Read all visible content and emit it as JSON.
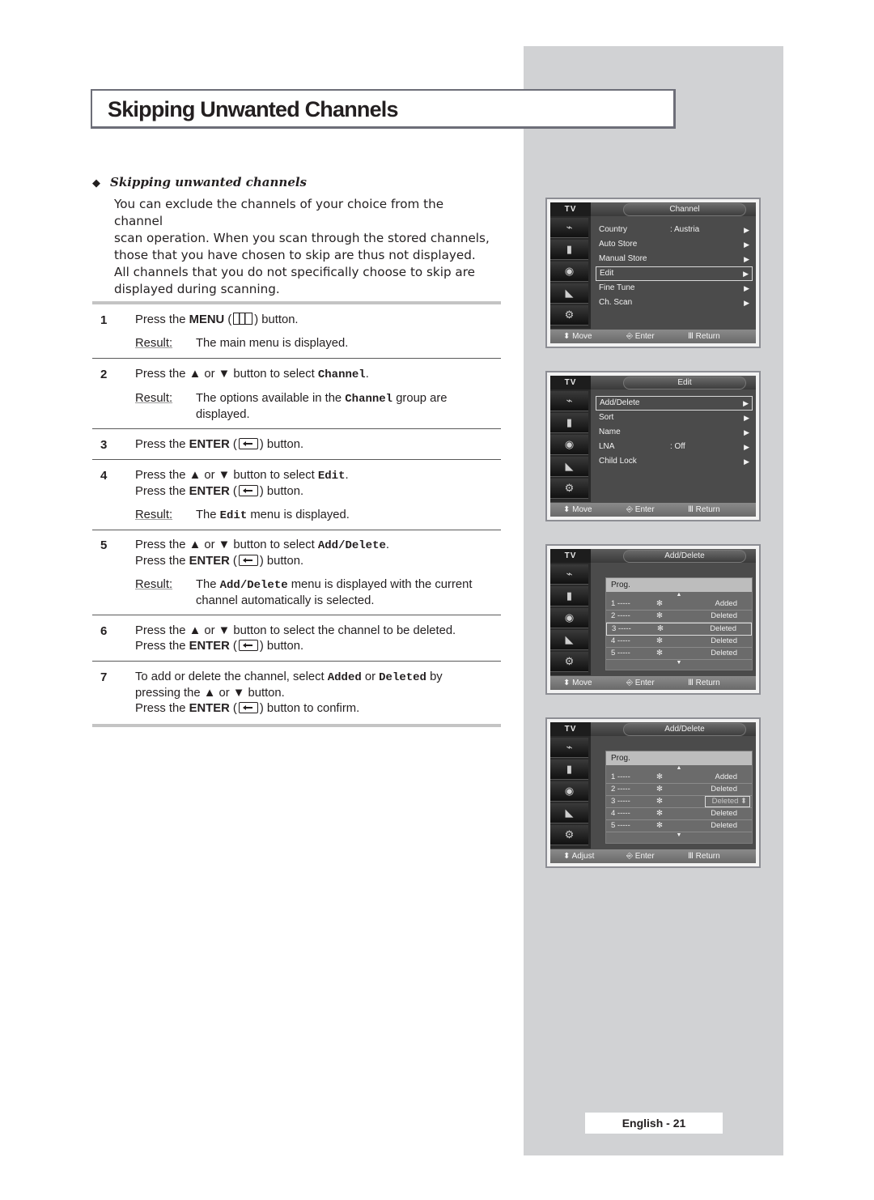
{
  "page": {
    "title": "Skipping Unwanted Channels",
    "subheading": "Skipping unwanted channels",
    "bullet_icon": "diamond-bullet",
    "intro_lines": [
      "You can exclude the channels of your choice from the channel",
      "scan operation. When you scan through the stored channels,",
      "those that you have chosen to skip are thus not displayed.",
      "All channels that you do not specifically choose to skip are",
      "displayed during scanning."
    ],
    "result_label": "Result",
    "footer": "English - 21"
  },
  "steps": [
    {
      "num": "1",
      "lines": [
        [
          "Press the ",
          {
            "b": "MENU"
          },
          " (",
          {
            "icon": "menu"
          },
          ") button."
        ]
      ],
      "result": [
        [
          "The main menu is displayed."
        ]
      ]
    },
    {
      "num": "2",
      "lines": [
        [
          "Press the ▲ or ▼ button to select ",
          {
            "mono": "Channel"
          },
          "."
        ]
      ],
      "result": [
        [
          "The options available in the ",
          {
            "mono": "Channel"
          },
          " group are"
        ],
        [
          "displayed."
        ]
      ]
    },
    {
      "num": "3",
      "lines": [
        [
          "Press the ",
          {
            "b": "ENTER"
          },
          " (",
          {
            "icon": "enter"
          },
          ") button."
        ]
      ]
    },
    {
      "num": "4",
      "lines": [
        [
          "Press the ▲ or ▼ button to select ",
          {
            "mono": "Edit"
          },
          "."
        ],
        [
          "Press the ",
          {
            "b": "ENTER"
          },
          " (",
          {
            "icon": "enter"
          },
          ") button."
        ]
      ],
      "result": [
        [
          "The ",
          {
            "mono": "Edit"
          },
          " menu is displayed."
        ]
      ]
    },
    {
      "num": "5",
      "lines": [
        [
          "Press the ▲ or ▼ button to select ",
          {
            "mono": "Add/Delete"
          },
          "."
        ],
        [
          "Press the ",
          {
            "b": "ENTER"
          },
          " (",
          {
            "icon": "enter"
          },
          ") button."
        ]
      ],
      "result": [
        [
          "The ",
          {
            "mono": "Add/Delete"
          },
          " menu is displayed with the current"
        ],
        [
          "channel automatically is selected."
        ]
      ]
    },
    {
      "num": "6",
      "lines": [
        [
          "Press the ▲ or ▼ button to select the channel to be deleted."
        ],
        [
          "Press the ",
          {
            "b": "ENTER"
          },
          " (",
          {
            "icon": "enter"
          },
          ") button."
        ]
      ]
    },
    {
      "num": "7",
      "lines": [
        [
          "To add or delete the channel, select ",
          {
            "mono": "Added"
          },
          " or ",
          {
            "mono": "Deleted"
          },
          " by"
        ],
        [
          "pressing the ▲ or ▼ button."
        ],
        [
          "Press the ",
          {
            "b": "ENTER"
          },
          " (",
          {
            "icon": "enter"
          },
          ") button to confirm."
        ]
      ]
    }
  ],
  "tv_screens": [
    {
      "tv_label": "TV",
      "title": "Channel",
      "type": "menu",
      "items": [
        {
          "label": "Country",
          "value": ":  Austria",
          "arrow": "▶",
          "selected": false
        },
        {
          "label": "Auto Store",
          "value": "",
          "arrow": "▶",
          "selected": false
        },
        {
          "label": "Manual Store",
          "value": "",
          "arrow": "▶",
          "selected": false
        },
        {
          "label": "Edit",
          "value": "",
          "arrow": "▶",
          "selected": true
        },
        {
          "label": "Fine Tune",
          "value": "",
          "arrow": "▶",
          "selected": false
        },
        {
          "label": "Ch. Scan",
          "value": "",
          "arrow": "▶",
          "selected": false
        }
      ],
      "footer": {
        "nav": "Move",
        "enter": "Enter",
        "return": "Return"
      }
    },
    {
      "tv_label": "TV",
      "title": "Edit",
      "type": "menu",
      "items": [
        {
          "label": "Add/Delete",
          "value": "",
          "arrow": "▶",
          "selected": true
        },
        {
          "label": "Sort",
          "value": "",
          "arrow": "▶",
          "selected": false
        },
        {
          "label": "Name",
          "value": "",
          "arrow": "▶",
          "selected": false
        },
        {
          "label": "LNA",
          "value": ":  Off",
          "arrow": "▶",
          "selected": false
        },
        {
          "label": "Child Lock",
          "value": "",
          "arrow": "▶",
          "selected": false
        }
      ],
      "footer": {
        "nav": "Move",
        "enter": "Enter",
        "return": "Return"
      }
    },
    {
      "tv_label": "TV",
      "title": "Add/Delete",
      "type": "list",
      "list_header": "Prog.",
      "rows": [
        {
          "prog": "1 -----",
          "mark": "✻",
          "status": "Added",
          "selected": false
        },
        {
          "prog": "2 -----",
          "mark": "✻",
          "status": "Deleted",
          "selected": false
        },
        {
          "prog": "3 -----",
          "mark": "✻",
          "status": "Deleted",
          "selected": true
        },
        {
          "prog": "4 -----",
          "mark": "✻",
          "status": "Deleted",
          "selected": false
        },
        {
          "prog": "5 -----",
          "mark": "✻",
          "status": "Deleted",
          "selected": false
        }
      ],
      "editing": false,
      "footer": {
        "nav": "Move",
        "enter": "Enter",
        "return": "Return"
      }
    },
    {
      "tv_label": "TV",
      "title": "Add/Delete",
      "type": "list",
      "list_header": "Prog.",
      "rows": [
        {
          "prog": "1 -----",
          "mark": "✻",
          "status": "Added",
          "selected": false
        },
        {
          "prog": "2 -----",
          "mark": "✻",
          "status": "Deleted",
          "selected": false
        },
        {
          "prog": "3 -----",
          "mark": "✻",
          "status": "Deleted",
          "selected": true
        },
        {
          "prog": "4 -----",
          "mark": "✻",
          "status": "Deleted",
          "selected": false
        },
        {
          "prog": "5 -----",
          "mark": "✻",
          "status": "Deleted",
          "selected": false
        }
      ],
      "editing": true,
      "footer": {
        "nav": "Adjust",
        "enter": "Enter",
        "return": "Return"
      }
    }
  ],
  "tv_sidebar_icons": [
    "input-icon",
    "picture-icon",
    "sound-icon",
    "channel-icon",
    "setup-icon"
  ],
  "colors": {
    "side_panel": "#d1d2d4",
    "title_border": "#6d6e78",
    "osd_bg": "#4b4b4b",
    "osd_footer": "#7a7a7a"
  }
}
